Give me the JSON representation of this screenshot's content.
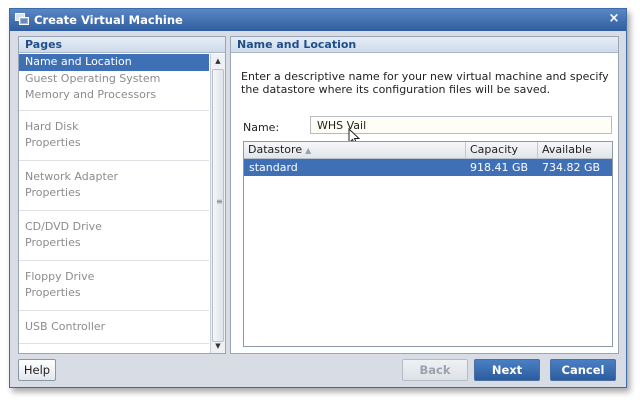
{
  "window": {
    "title": "Create Virtual Machine",
    "close_glyph": "×"
  },
  "pages_panel": {
    "header": "Pages",
    "groups": [
      [
        "Name and Location",
        "Guest Operating System",
        "Memory and Processors"
      ],
      [
        "Hard Disk",
        "Properties"
      ],
      [
        "Network Adapter",
        "Properties"
      ],
      [
        "CD/DVD Drive",
        "Properties"
      ],
      [
        "Floppy Drive",
        "Properties"
      ],
      [
        "USB Controller"
      ]
    ],
    "selected": "Name and Location"
  },
  "main_panel": {
    "header": "Name and Location",
    "description": "Enter a descriptive name for your new virtual machine and specify the datastore where its configuration files will be saved.",
    "name_label": "Name:",
    "name_value": "WHS Vail",
    "table": {
      "columns": [
        "Datastore",
        "Capacity",
        "Available"
      ],
      "sort_indicator": "▲",
      "rows": [
        {
          "datastore": "standard",
          "capacity": "918.41 GB",
          "available": "734.82 GB"
        }
      ]
    }
  },
  "buttons": {
    "help": "Help",
    "back": "Back",
    "next": "Next",
    "cancel": "Cancel"
  },
  "colors": {
    "title_bar": "#2f5e9e",
    "selection": "#3f6fb5",
    "header_text": "#1f4f8a"
  },
  "icons": {
    "app": "virtual-machine-icon",
    "close": "close-icon",
    "scroll_up": "scroll-up-arrow-icon",
    "scroll_down": "scroll-down-arrow-icon",
    "mouse_cursor": "mouse-pointer-icon"
  }
}
